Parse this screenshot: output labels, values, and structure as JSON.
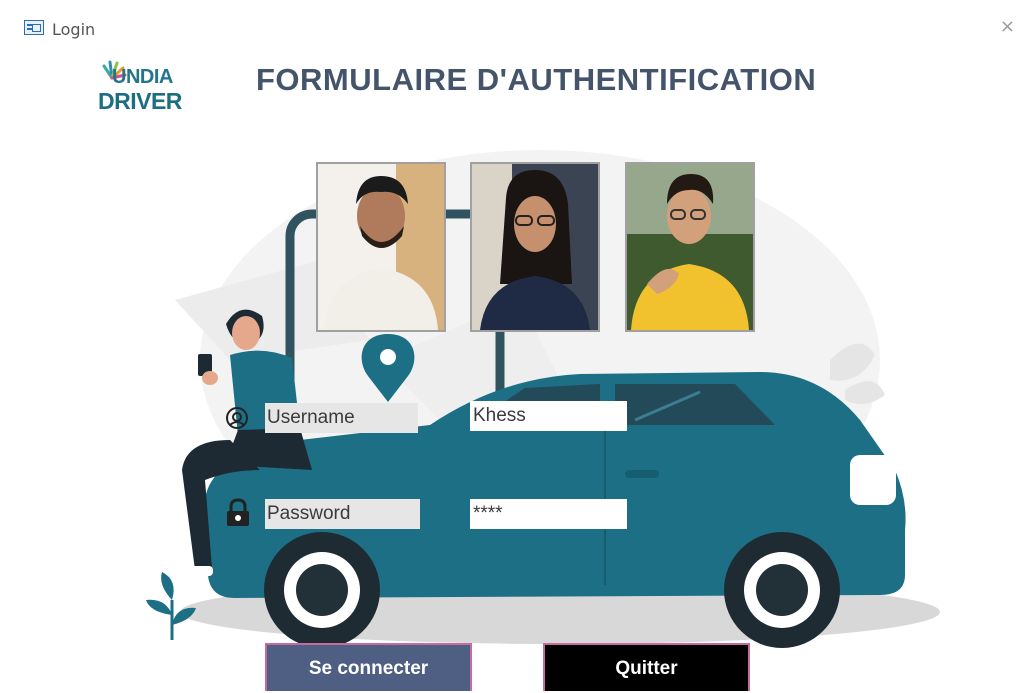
{
  "window": {
    "title": "Login",
    "close_glyph": "×",
    "icon": "form-icon"
  },
  "logo": {
    "line1": "UNDIA",
    "line2": "DRIVER",
    "brand_color": "#1d6d83"
  },
  "heading": "FORMULAIRE D'AUTHENTIFICATION",
  "form": {
    "username": {
      "label": "Username",
      "value": "Khess",
      "icon": "location-icon"
    },
    "password": {
      "label": "Password",
      "value": "****",
      "icon": "padlock-icon"
    }
  },
  "buttons": {
    "connect": "Se connecter",
    "quit": "Quitter"
  },
  "colors": {
    "car": "#1d6f86",
    "heading": "#44546a",
    "connect_button": "#4e5f83",
    "quit_button": "#000000",
    "button_border": "#c76aa0"
  }
}
